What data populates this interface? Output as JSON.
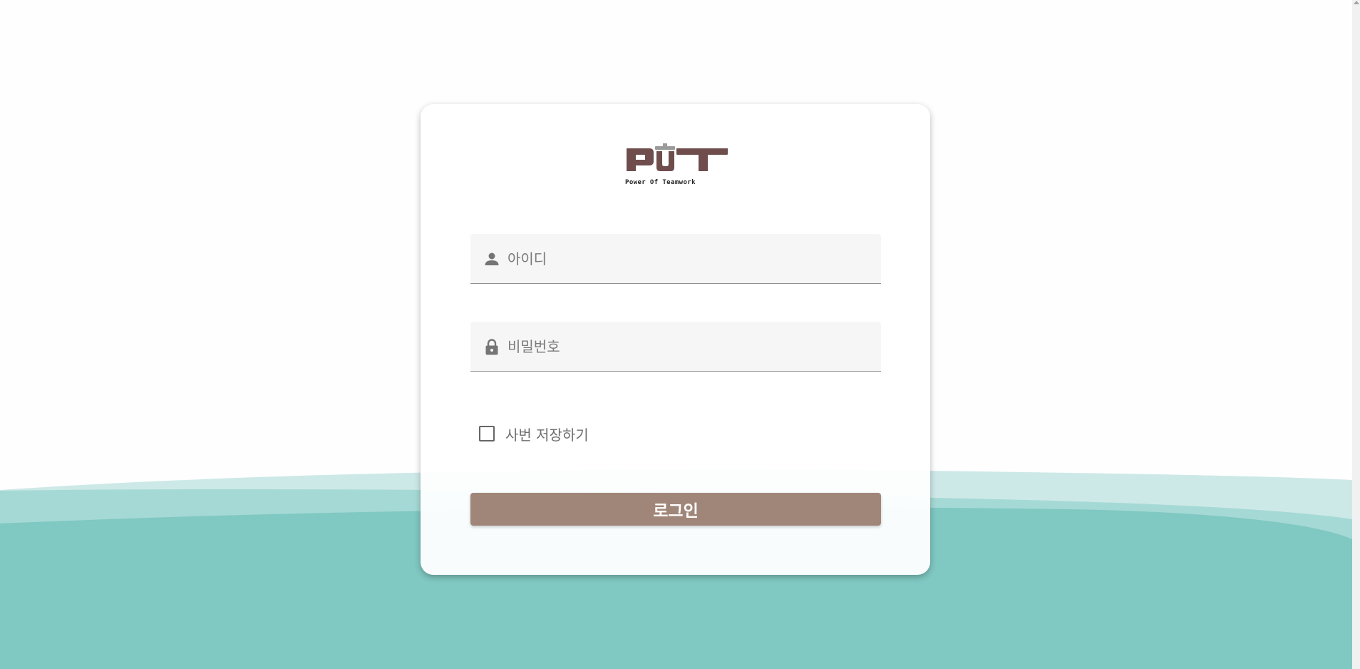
{
  "colors": {
    "background": "#fefefe",
    "wave_light": "#cde9e7",
    "wave_mid": "#a5d9d5",
    "wave_dark": "#80c8c2",
    "button": "#a08679",
    "logo_brown": "#6e4d4c",
    "logo_gray": "#9a9a9a"
  },
  "logo": {
    "letters": [
      "P",
      "T"
    ],
    "tagline": "Power Of Teamwork"
  },
  "login_form": {
    "id_placeholder": "아이디",
    "id_icon": "person-icon",
    "password_placeholder": "비밀번호",
    "password_icon": "lock-icon",
    "remember_label": "사번 저장하기",
    "remember_checked": false,
    "submit_label": "로그인"
  }
}
